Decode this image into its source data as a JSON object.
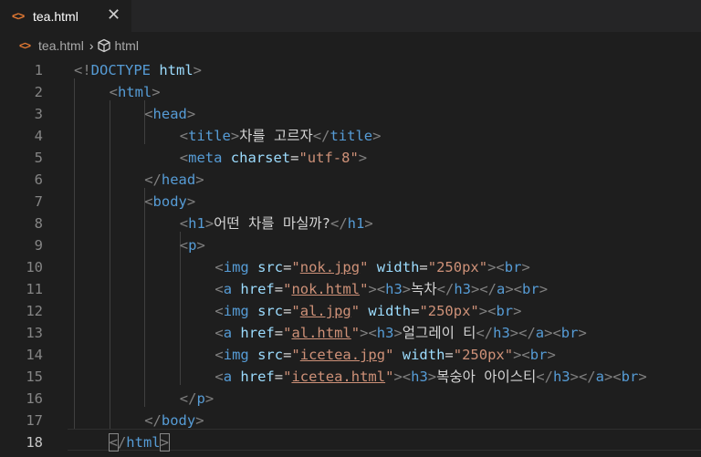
{
  "tab": {
    "label": "tea.html",
    "close": "✕"
  },
  "breadcrumb": {
    "file": "tea.html",
    "symbol": "html"
  },
  "editor": {
    "active_line": 18
  },
  "lines": [
    {
      "n": "1",
      "parts": [
        {
          "c": "p",
          "t": "<!"
        },
        {
          "c": "t",
          "t": "DOCTYPE"
        },
        {
          "c": "a",
          "t": " html"
        },
        {
          "c": "p",
          "t": ">"
        }
      ]
    },
    {
      "n": "2",
      "parts": [
        {
          "c": "p",
          "t": "<"
        },
        {
          "c": "t",
          "t": "html"
        },
        {
          "c": "p",
          "t": ">"
        }
      ]
    },
    {
      "n": "3",
      "parts": [
        {
          "c": "p",
          "t": "<"
        },
        {
          "c": "t",
          "t": "head"
        },
        {
          "c": "p",
          "t": ">"
        }
      ]
    },
    {
      "n": "4",
      "parts": [
        {
          "c": "p",
          "t": "<"
        },
        {
          "c": "t",
          "t": "title"
        },
        {
          "c": "p",
          "t": ">"
        },
        {
          "c": "txt",
          "t": "차를 고르자"
        },
        {
          "c": "p",
          "t": "</"
        },
        {
          "c": "t",
          "t": "title"
        },
        {
          "c": "p",
          "t": ">"
        }
      ]
    },
    {
      "n": "5",
      "parts": [
        {
          "c": "p",
          "t": "<"
        },
        {
          "c": "t",
          "t": "meta"
        },
        {
          "c": "a",
          "t": " charset"
        },
        {
          "c": "txt",
          "t": "="
        },
        {
          "c": "s",
          "t": "\"utf-8\""
        },
        {
          "c": "p",
          "t": ">"
        }
      ]
    },
    {
      "n": "6",
      "parts": [
        {
          "c": "p",
          "t": "</"
        },
        {
          "c": "t",
          "t": "head"
        },
        {
          "c": "p",
          "t": ">"
        }
      ]
    },
    {
      "n": "7",
      "parts": [
        {
          "c": "p",
          "t": "<"
        },
        {
          "c": "t",
          "t": "body"
        },
        {
          "c": "p",
          "t": ">"
        }
      ]
    },
    {
      "n": "8",
      "parts": [
        {
          "c": "p",
          "t": "<"
        },
        {
          "c": "t",
          "t": "h1"
        },
        {
          "c": "p",
          "t": ">"
        },
        {
          "c": "txt",
          "t": "어떤 차를 마실까?"
        },
        {
          "c": "p",
          "t": "</"
        },
        {
          "c": "t",
          "t": "h1"
        },
        {
          "c": "p",
          "t": ">"
        }
      ]
    },
    {
      "n": "9",
      "parts": [
        {
          "c": "p",
          "t": "<"
        },
        {
          "c": "t",
          "t": "p"
        },
        {
          "c": "p",
          "t": ">"
        }
      ]
    },
    {
      "n": "10",
      "parts": [
        {
          "c": "p",
          "t": "<"
        },
        {
          "c": "t",
          "t": "img"
        },
        {
          "c": "a",
          "t": " src"
        },
        {
          "c": "txt",
          "t": "="
        },
        {
          "c": "s",
          "t": "\""
        },
        {
          "c": "s u",
          "t": "nok.jpg"
        },
        {
          "c": "s",
          "t": "\""
        },
        {
          "c": "a",
          "t": " width"
        },
        {
          "c": "txt",
          "t": "="
        },
        {
          "c": "s",
          "t": "\"250px\""
        },
        {
          "c": "p",
          "t": "><"
        },
        {
          "c": "t",
          "t": "br"
        },
        {
          "c": "p",
          "t": ">"
        }
      ]
    },
    {
      "n": "11",
      "parts": [
        {
          "c": "p",
          "t": "<"
        },
        {
          "c": "t",
          "t": "a"
        },
        {
          "c": "a",
          "t": " href"
        },
        {
          "c": "txt",
          "t": "="
        },
        {
          "c": "s",
          "t": "\""
        },
        {
          "c": "s u",
          "t": "nok.html"
        },
        {
          "c": "s",
          "t": "\""
        },
        {
          "c": "p",
          "t": "><"
        },
        {
          "c": "t",
          "t": "h3"
        },
        {
          "c": "p",
          "t": ">"
        },
        {
          "c": "txt",
          "t": "녹차"
        },
        {
          "c": "p",
          "t": "</"
        },
        {
          "c": "t",
          "t": "h3"
        },
        {
          "c": "p",
          "t": "></"
        },
        {
          "c": "t",
          "t": "a"
        },
        {
          "c": "p",
          "t": "><"
        },
        {
          "c": "t",
          "t": "br"
        },
        {
          "c": "p",
          "t": ">"
        }
      ]
    },
    {
      "n": "12",
      "parts": [
        {
          "c": "p",
          "t": "<"
        },
        {
          "c": "t",
          "t": "img"
        },
        {
          "c": "a",
          "t": " src"
        },
        {
          "c": "txt",
          "t": "="
        },
        {
          "c": "s",
          "t": "\""
        },
        {
          "c": "s u",
          "t": "al.jpg"
        },
        {
          "c": "s",
          "t": "\""
        },
        {
          "c": "a",
          "t": " width"
        },
        {
          "c": "txt",
          "t": "="
        },
        {
          "c": "s",
          "t": "\"250px\""
        },
        {
          "c": "p",
          "t": "><"
        },
        {
          "c": "t",
          "t": "br"
        },
        {
          "c": "p",
          "t": ">"
        }
      ]
    },
    {
      "n": "13",
      "parts": [
        {
          "c": "p",
          "t": "<"
        },
        {
          "c": "t",
          "t": "a"
        },
        {
          "c": "a",
          "t": " href"
        },
        {
          "c": "txt",
          "t": "="
        },
        {
          "c": "s",
          "t": "\""
        },
        {
          "c": "s u",
          "t": "al.html"
        },
        {
          "c": "s",
          "t": "\""
        },
        {
          "c": "p",
          "t": "><"
        },
        {
          "c": "t",
          "t": "h3"
        },
        {
          "c": "p",
          "t": ">"
        },
        {
          "c": "txt",
          "t": "얼그레이 티"
        },
        {
          "c": "p",
          "t": "</"
        },
        {
          "c": "t",
          "t": "h3"
        },
        {
          "c": "p",
          "t": "></"
        },
        {
          "c": "t",
          "t": "a"
        },
        {
          "c": "p",
          "t": "><"
        },
        {
          "c": "t",
          "t": "br"
        },
        {
          "c": "p",
          "t": ">"
        }
      ]
    },
    {
      "n": "14",
      "parts": [
        {
          "c": "p",
          "t": "<"
        },
        {
          "c": "t",
          "t": "img"
        },
        {
          "c": "a",
          "t": " src"
        },
        {
          "c": "txt",
          "t": "="
        },
        {
          "c": "s",
          "t": "\""
        },
        {
          "c": "s u",
          "t": "icetea.jpg"
        },
        {
          "c": "s",
          "t": "\""
        },
        {
          "c": "a",
          "t": " width"
        },
        {
          "c": "txt",
          "t": "="
        },
        {
          "c": "s",
          "t": "\"250px\""
        },
        {
          "c": "p",
          "t": "><"
        },
        {
          "c": "t",
          "t": "br"
        },
        {
          "c": "p",
          "t": ">"
        }
      ]
    },
    {
      "n": "15",
      "parts": [
        {
          "c": "p",
          "t": "<"
        },
        {
          "c": "t",
          "t": "a"
        },
        {
          "c": "a",
          "t": " href"
        },
        {
          "c": "txt",
          "t": "="
        },
        {
          "c": "s",
          "t": "\""
        },
        {
          "c": "s u",
          "t": "icetea.html"
        },
        {
          "c": "s",
          "t": "\""
        },
        {
          "c": "p",
          "t": "><"
        },
        {
          "c": "t",
          "t": "h3"
        },
        {
          "c": "p",
          "t": ">"
        },
        {
          "c": "txt",
          "t": "복숭아 아이스티"
        },
        {
          "c": "p",
          "t": "</"
        },
        {
          "c": "t",
          "t": "h3"
        },
        {
          "c": "p",
          "t": "></"
        },
        {
          "c": "t",
          "t": "a"
        },
        {
          "c": "p",
          "t": "><"
        },
        {
          "c": "t",
          "t": "br"
        },
        {
          "c": "p",
          "t": ">"
        }
      ]
    },
    {
      "n": "16",
      "parts": [
        {
          "c": "p",
          "t": "</"
        },
        {
          "c": "t",
          "t": "p"
        },
        {
          "c": "p",
          "t": ">"
        }
      ]
    },
    {
      "n": "17",
      "parts": [
        {
          "c": "p",
          "t": "</"
        },
        {
          "c": "t",
          "t": "body"
        },
        {
          "c": "p",
          "t": ">"
        }
      ]
    },
    {
      "n": "18",
      "parts": [
        {
          "c": "p bm",
          "t": "<"
        },
        {
          "c": "p",
          "t": "/"
        },
        {
          "c": "t",
          "t": "html"
        },
        {
          "c": "p bm",
          "t": ">"
        }
      ]
    }
  ]
}
